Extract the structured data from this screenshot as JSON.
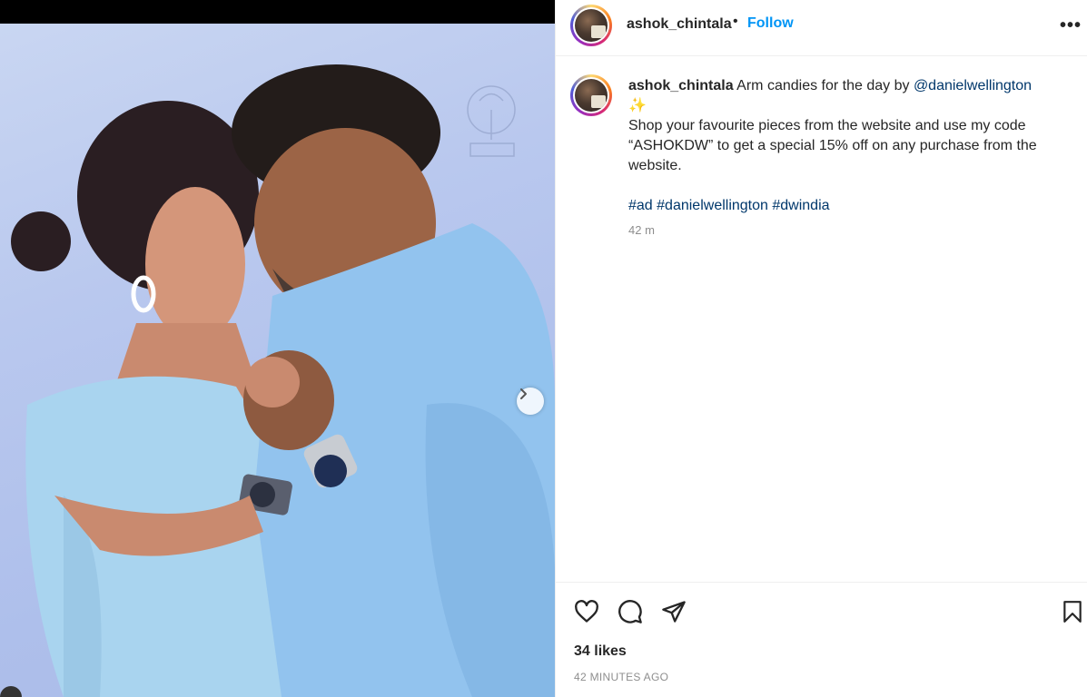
{
  "post": {
    "username": "ashok_chintala",
    "separator": "•",
    "follow_label": "Follow",
    "more_label": "•••",
    "caption": {
      "username": "ashok_chintala",
      "text_1": " Arm candies for the day by ",
      "mention": "@danielwellington",
      "emoji": "✨",
      "text_2": "Shop your favourite pieces from the website and use my code “ASHOKDW” to get a special 15% off on any purchase from the website.",
      "tags": [
        "#ad",
        "#danielwellington",
        "#dwindia"
      ]
    },
    "caption_time": "42 m",
    "likes": "34 likes",
    "posted_ago": "42 MINUTES AGO"
  },
  "icons": {
    "like": "heart-icon",
    "comment": "comment-icon",
    "share": "send-icon",
    "save": "bookmark-icon",
    "next": "chevron-right-icon",
    "more": "more-options-icon"
  },
  "colors": {
    "follow": "#0095f6",
    "link": "#00376b",
    "text": "#262626",
    "muted": "#8e8e8e",
    "photo_bg": "#b9c8ee"
  }
}
